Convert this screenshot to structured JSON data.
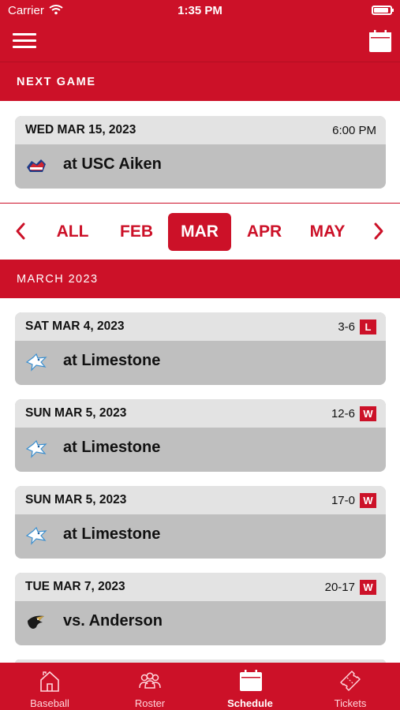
{
  "status_bar": {
    "carrier": "Carrier",
    "time": "1:35 PM",
    "battery_level": 0.9
  },
  "header": {
    "next_label": "NEXT GAME",
    "menu_icon": "hamburger-menu-icon",
    "calendar_icon": "calendar-icon"
  },
  "next_game": {
    "date": "WED MAR 15, 2023",
    "time": "6:00 PM",
    "opponent": "at USC Aiken",
    "logo": "usc-aiken-logo"
  },
  "months": {
    "prev_icon": "chevron-left-icon",
    "next_icon": "chevron-right-icon",
    "items": [
      "ALL",
      "FEB",
      "MAR",
      "APR",
      "MAY"
    ],
    "selected": "MAR"
  },
  "section": {
    "title": "MARCH 2023"
  },
  "games": [
    {
      "date": "SAT MAR 4, 2023",
      "score": "3-6",
      "result": "L",
      "opponent": "at Limestone",
      "logo": "limestone-logo"
    },
    {
      "date": "SUN MAR 5, 2023",
      "score": "12-6",
      "result": "W",
      "opponent": "at Limestone",
      "logo": "limestone-logo"
    },
    {
      "date": "SUN MAR 5, 2023",
      "score": "17-0",
      "result": "W",
      "opponent": "at Limestone",
      "logo": "limestone-logo"
    },
    {
      "date": "TUE MAR 7, 2023",
      "score": "20-17",
      "result": "W",
      "opponent": "vs. Anderson",
      "logo": "anderson-logo"
    }
  ],
  "tabs": [
    {
      "label": "Baseball",
      "icon": "home-icon"
    },
    {
      "label": "Roster",
      "icon": "people-icon"
    },
    {
      "label": "Schedule",
      "icon": "calendar-icon"
    },
    {
      "label": "Tickets",
      "icon": "ticket-icon"
    }
  ],
  "colors": {
    "brand_red": "#cc1128",
    "card_header": "#e3e3e3",
    "card_body": "#bfbfbf"
  }
}
